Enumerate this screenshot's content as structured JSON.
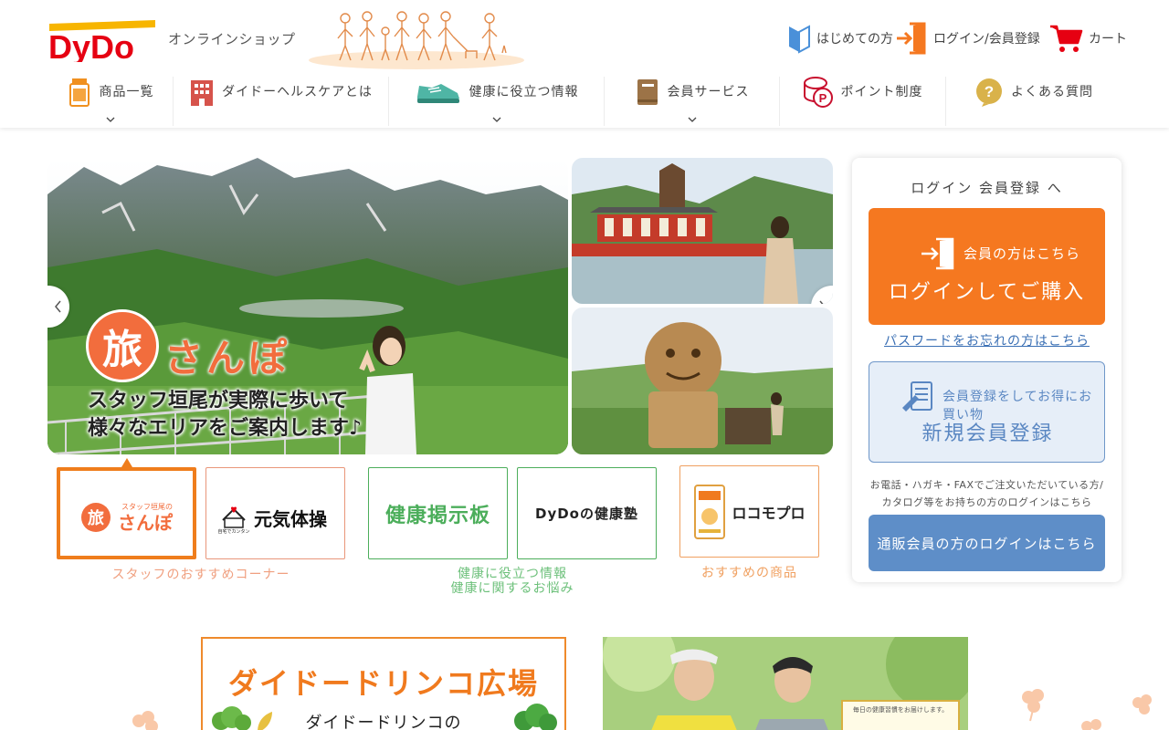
{
  "header": {
    "logo_text": "DyDo",
    "shop_label": "オンラインショップ",
    "utility": {
      "beginner_label": "はじめての方",
      "login_label": "ログイン/会員登録",
      "cart_label": "カート"
    },
    "nav": [
      {
        "label": "商品一覧",
        "has_dropdown": true,
        "icon": "supplement-bottle-icon"
      },
      {
        "label": "ダイドーヘルスケアとは",
        "has_dropdown": false,
        "icon": "building-icon"
      },
      {
        "label": "健康に役立つ情報",
        "has_dropdown": true,
        "icon": "sneaker-icon"
      },
      {
        "label": "会員サービス",
        "has_dropdown": true,
        "icon": "book-icon"
      },
      {
        "label": "ポイント制度",
        "has_dropdown": false,
        "icon": "point-coin-icon"
      },
      {
        "label": "よくある質問",
        "has_dropdown": false,
        "icon": "question-bubble-icon"
      }
    ]
  },
  "hero": {
    "tabi_char": "旅",
    "sanpo_text": "さんぽ",
    "caption_line1": "スタッフ垣尾が実際に歩いて",
    "caption_line2": "様々なエリアをご案内します♪"
  },
  "thumbs": [
    {
      "label_main": "旅",
      "label_small": "スタッフ垣尾の",
      "label_sub": "さんぽ",
      "active": true,
      "color": "#f26d3d"
    },
    {
      "label_main": "元気体操",
      "label_small": "自宅でカンタン",
      "active": false,
      "color": "#e9967a"
    },
    {
      "label_main": "健康掲示板",
      "active": false,
      "color": "#4cae5b"
    },
    {
      "label_main": "DyDoの健康塾",
      "active": false,
      "color": "#4cae5b"
    },
    {
      "label_main": "ロコモプロ",
      "active": false,
      "color": "#f0a060"
    }
  ],
  "categories": {
    "cat1": "スタッフのおすすめコーナー",
    "cat2_line1": "健康に役立つ情報",
    "cat2_line2": "健康に関するお悩み",
    "cat3": "おすすめの商品"
  },
  "login_panel": {
    "title": "ログイン 会員登録 へ",
    "member_sub": "会員の方はこちら",
    "member_main": "ログインしてご購入",
    "forgot_link": "パスワードをお忘れの方はこちら",
    "register_sub": "会員登録をしてお得にお買い物",
    "register_main": "新規会員登録",
    "note_line1": "お電話・ハガキ・FAXでご注文いただいている方/",
    "note_line2": "カタログ等をお持ちの方のログインはこちら",
    "other_button": "通販会員の方のログインはこちら"
  },
  "banners": {
    "left_title": "ダイドードリンコ広場",
    "left_sub": "ダイドードリンコの",
    "right_small_text": "毎日の健康習慣をお届けします。"
  },
  "colors": {
    "brand_orange": "#f57820",
    "brand_red": "#e60012",
    "register_blue": "#5e8ec8"
  }
}
